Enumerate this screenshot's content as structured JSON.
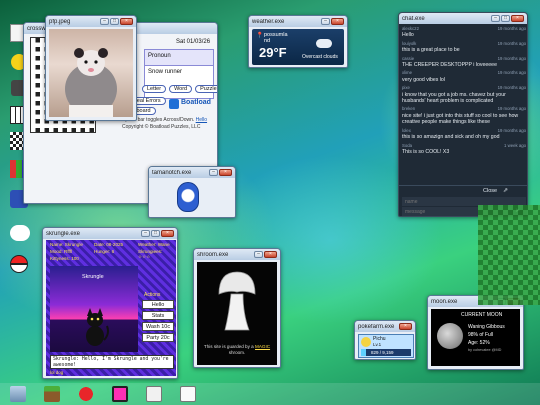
{
  "pfp": {
    "title": "pfp.jpeg",
    "dialog_title": "crossw",
    "date": "Sat 01/03/26",
    "field_label": "Pronoun",
    "field_value": "Snow runner",
    "buttons": [
      "Letter",
      "Word",
      "Puzzle"
    ],
    "btn_left": [
      "Reveal Errors",
      "Keyboard"
    ],
    "brand": "Boatload",
    "footer_1": "Space bar toggles Across/Down.",
    "footer_link": "Hello",
    "footer_2": "Copyright © Boatload Puzzles, LLC"
  },
  "weather": {
    "title": "weather.exe",
    "location": "possumla nd",
    "temp": "29°F",
    "condition": "Overcast clouds"
  },
  "chat": {
    "title": "chat.exe",
    "messages": [
      {
        "user": "alexkc22",
        "time": "19 months ago",
        "text": "Hello"
      },
      {
        "user": "louiyolk",
        "time": "19 months ago",
        "text": "this is a great place to be"
      },
      {
        "user": "cassie",
        "time": "19 months ago",
        "text": "THE CREEPER DESKTOPPP i loveeeee"
      },
      {
        "user": "xlime",
        "time": "19 months ago",
        "text": "very good vibes lol"
      },
      {
        "user": "pixe",
        "time": "19 months ago",
        "text": "i know that you got a job ms. chavez but your husbands' heart problem is complicated"
      },
      {
        "user": "breken",
        "time": "19 months ago",
        "text": "nice site! i just got into this stuff so cool to see how creative people make things like these"
      },
      {
        "user": "lolex",
        "time": "19 months ago",
        "text": "this is so amazign and sick and oh my god"
      },
      {
        "user": "Soda",
        "time": "1 week ago",
        "text": "This is so COOL! X3"
      }
    ],
    "close_label": "Close",
    "name_placeholder": "name",
    "message_placeholder": "message"
  },
  "tama": {
    "title": "tamanotch.exe"
  },
  "skrungle": {
    "title": "skrungle.exe",
    "stats": [
      "Name: Skrungle",
      "Date: 08-2025",
      "Weather: Wane",
      "Mood: Rfffl",
      "Hunger: 6",
      "Kittyness: 100",
      "Skrungiees: ☆☆☆"
    ],
    "name": "Skrungle",
    "actions_label": "Actions",
    "actions": [
      "Hello",
      "Stats",
      "Wash 10c",
      "Party 20c"
    ],
    "dialogue": "Skrungle: Hello, I'm Skrungle and you're awesome!",
    "footer": "lol dog"
  },
  "shroom": {
    "title": "shroom.exe",
    "caption": "This site is guarded by a",
    "link": "MAGIC",
    "caption2": "shroom."
  },
  "moon": {
    "title": "moon.exe",
    "header": "CURRENT MOON",
    "phase": "Waning Gibbous",
    "full": "98% of Full",
    "age": "Age: 52%",
    "small": "by cohevatee @MD"
  },
  "poke": {
    "title": "pokefarm.exe",
    "name": "Pichu",
    "level": "Lv.1",
    "exp": "829 / 9,159",
    "progress": 0.09
  },
  "colors": {
    "chat_bg": "#1f2a36",
    "accent": "#2d6fd1",
    "sky_blue": "#6ab0ff"
  },
  "taskbar": {
    "icons": [
      "computer-icon",
      "minecraft-block-icon",
      "apple-icon",
      "heart-icon",
      "mail-icon",
      "notes-icon"
    ]
  }
}
